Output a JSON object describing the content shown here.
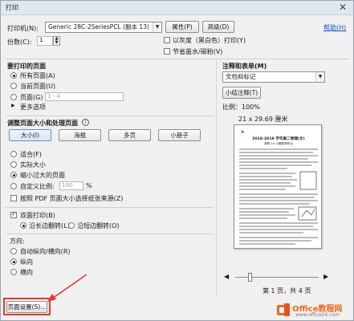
{
  "window": {
    "title": "打印"
  },
  "header": {
    "printer_label": "打印机(N):",
    "printer_value": "Generic 28C-2SeriesPCL (副本 13)",
    "properties_btn": "属性(P)",
    "advanced_btn": "高级(D)",
    "help_link": "帮助(H)",
    "copies_label": "份数(C):",
    "copies_value": "1",
    "grayscale_label": "以灰度（黑白色）打印(Y)",
    "ink_label": "节省墨水/碳粉(V)"
  },
  "pages_to_print": {
    "title": "要打印的页面",
    "all_pages": "所有页面(A)",
    "current_page": "当前页面(U)",
    "pages_label": "页面(G)",
    "pages_placeholder": "1 - 4",
    "more_options": "更多选项"
  },
  "page_sizing": {
    "title": "调整页面大小和处理页面",
    "buttons": [
      "大小(I)",
      "海报",
      "多页",
      "小册子"
    ],
    "fit": "适合(F)",
    "actual_size": "实际大小",
    "shrink": "缩小过大的页面",
    "custom_scale": "自定义比例:",
    "custom_scale_value": "100",
    "percent": "%",
    "paper_source": "按照 PDF 页面大小选择纸张来源(Z)"
  },
  "duplex": {
    "label": "双面打印(B)",
    "long_edge": "沿长边翻转(L)",
    "short_edge": "沿短边翻转(O)"
  },
  "orientation": {
    "title": "方向:",
    "auto": "自动纵向/横向(R)",
    "portrait": "纵向",
    "landscape": "横向"
  },
  "comments": {
    "title": "注释和表单(M)",
    "value": "文档和标记",
    "summarize_btn": "小结注释(T)"
  },
  "preview": {
    "scale": "比例：100%",
    "dimensions": "21 x 29.69 厘米",
    "doc_header": "2018-2019 学年高二物理(文)",
    "doc_subtitle": "周练 14 小题周测作业",
    "page_status": "第 1 页，共 4 页"
  },
  "footer": {
    "page_setup_btn": "页面设置(S)..."
  },
  "watermark": {
    "brand": "Office教程网",
    "url": "www.office26.com"
  },
  "colors": {
    "accent_red": "#e03a2f",
    "office_orange": "#f06a1d",
    "link_blue": "#1a56c2"
  }
}
